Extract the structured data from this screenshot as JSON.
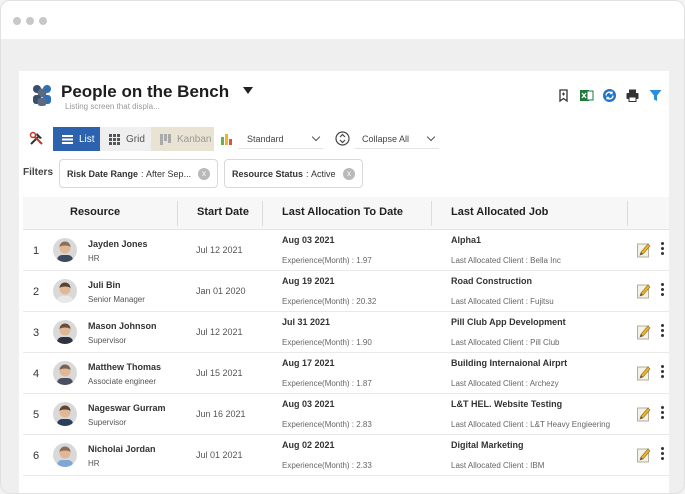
{
  "page": {
    "title": "People on the Bench",
    "subtitle": "Listing screen that displa..."
  },
  "toolbar": {
    "views": {
      "list": "List",
      "grid": "Grid",
      "kanban": "Kanban"
    },
    "layout_select": "Standard",
    "collapse_select": "Collapse All"
  },
  "filters": {
    "label": "Filters",
    "chips": [
      {
        "name": "Risk Date Range",
        "value": "After Sep..."
      },
      {
        "name": "Resource Status",
        "value": "Active"
      }
    ]
  },
  "table": {
    "columns": {
      "resource": "Resource",
      "start_date": "Start Date",
      "last_allocation": "Last Allocation To Date",
      "last_job": "Last Allocated Job"
    },
    "rows": [
      {
        "num": "1",
        "name": "Jayden Jones",
        "role": "HR",
        "start": "Jul 12 2021",
        "alloc": "Aug 03 2021",
        "exp": "Experience(Month) : 1.97",
        "job": "Alpha1",
        "client": "Last Allocated Client : Bella Inc",
        "avatar_color": "#8a6d5a",
        "shirt": "#3b4a5e"
      },
      {
        "num": "2",
        "name": "Juli Bin",
        "role": "Senior Manager",
        "start": "Jan 01 2020",
        "alloc": "Aug 19 2021",
        "exp": "Experience(Month) : 20.32",
        "job": "Road Construction",
        "client": "Last Allocated Client : Fujitsu",
        "avatar_color": "#5a3f33",
        "shirt": "#e8e8e8"
      },
      {
        "num": "3",
        "name": "Mason Johnson",
        "role": "Supervisor",
        "start": "Jul 12 2021",
        "alloc": "Jul 31 2021",
        "exp": "Experience(Month) : 1.90",
        "job": "Pill Club App Development",
        "client": "Last Allocated Client : Pill Club",
        "avatar_color": "#6b4c3b",
        "shirt": "#2f3440"
      },
      {
        "num": "4",
        "name": "Matthew Thomas",
        "role": "Associate engineer",
        "start": "Jul 15 2021",
        "alloc": "Aug 17 2021",
        "exp": "Experience(Month) : 1.87",
        "job": "Building Internaional Airprt",
        "client": "Last Allocated Client : Archezy",
        "avatar_color": "#7a6050",
        "shirt": "#4a5060"
      },
      {
        "num": "5",
        "name": "Nageswar Gurram",
        "role": "Supervisor",
        "start": "Jun 16 2021",
        "alloc": "Aug 03 2021",
        "exp": "Experience(Month) : 2.83",
        "job": "L&T HEL. Website Testing",
        "client": "Last Allocated Client : L&T Heavy Engieering",
        "avatar_color": "#5e4536",
        "shirt": "#2c3e5c"
      },
      {
        "num": "6",
        "name": "Nicholai Jordan",
        "role": "HR",
        "start": "Jul 01 2021",
        "alloc": "Aug 02 2021",
        "exp": "Experience(Month) : 2.33",
        "job": "Digital Marketing",
        "client": "Last Allocated Client : IBM",
        "avatar_color": "#8c6a55",
        "shirt": "#7fa7d6"
      }
    ]
  },
  "colors": {
    "accent": "#2d62ae",
    "excel": "#1e7a3c",
    "filter": "#2a8de0"
  }
}
